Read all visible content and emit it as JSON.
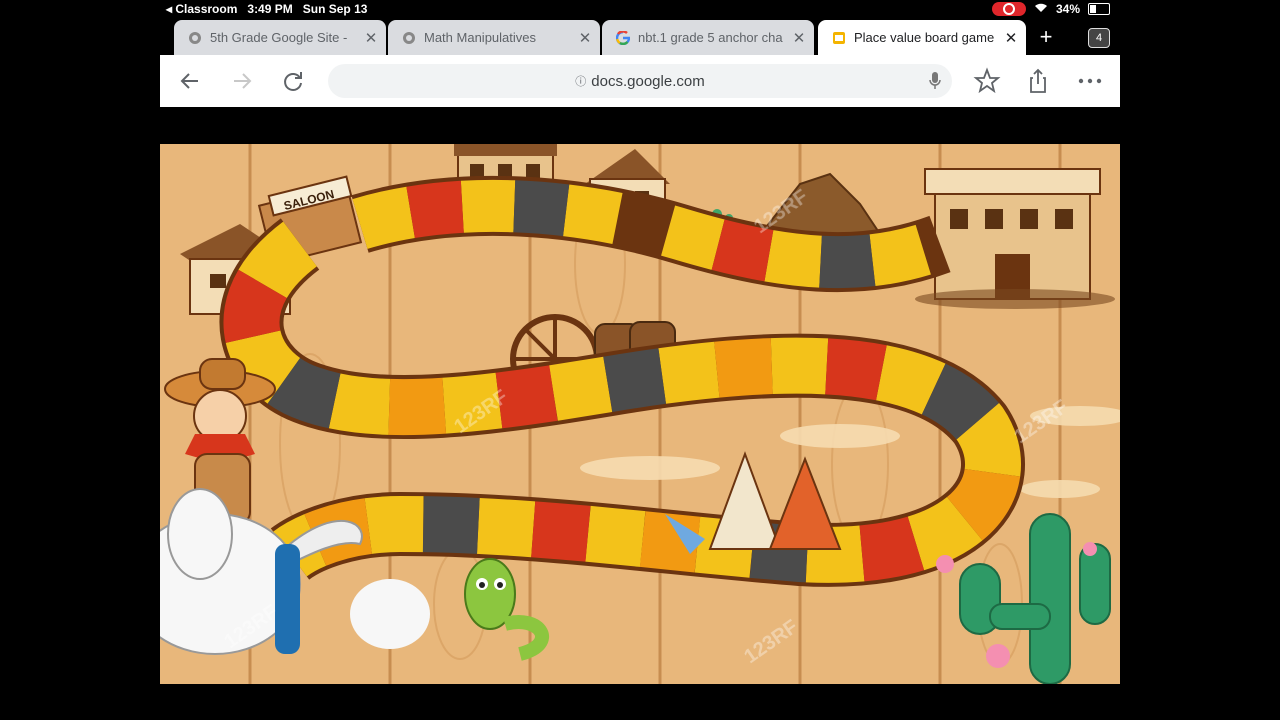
{
  "status": {
    "back_app": "◂ Classroom",
    "time": "3:49 PM",
    "date": "Sun Sep 13",
    "battery": "34%"
  },
  "tabs": [
    {
      "label": "5th Grade Google Site -",
      "icon": "globe-icon",
      "active": false
    },
    {
      "label": "Math Manipulatives",
      "icon": "globe-icon",
      "active": false
    },
    {
      "label": "nbt.1 grade 5 anchor cha",
      "icon": "google-icon",
      "active": false
    },
    {
      "label": "Place value board game",
      "icon": "slides-icon",
      "active": true
    }
  ],
  "tab_count": "4",
  "toolbar": {
    "url": "docs.google.com"
  },
  "board": {
    "saloon_sign": "SALOON",
    "watermark": "123RF",
    "colors": {
      "yellow": "#f3c21a",
      "orange": "#f29a12",
      "red": "#d7361c",
      "dark": "#4b4b4b",
      "outline": "#6b3410",
      "wood": "#e8b77b"
    }
  }
}
